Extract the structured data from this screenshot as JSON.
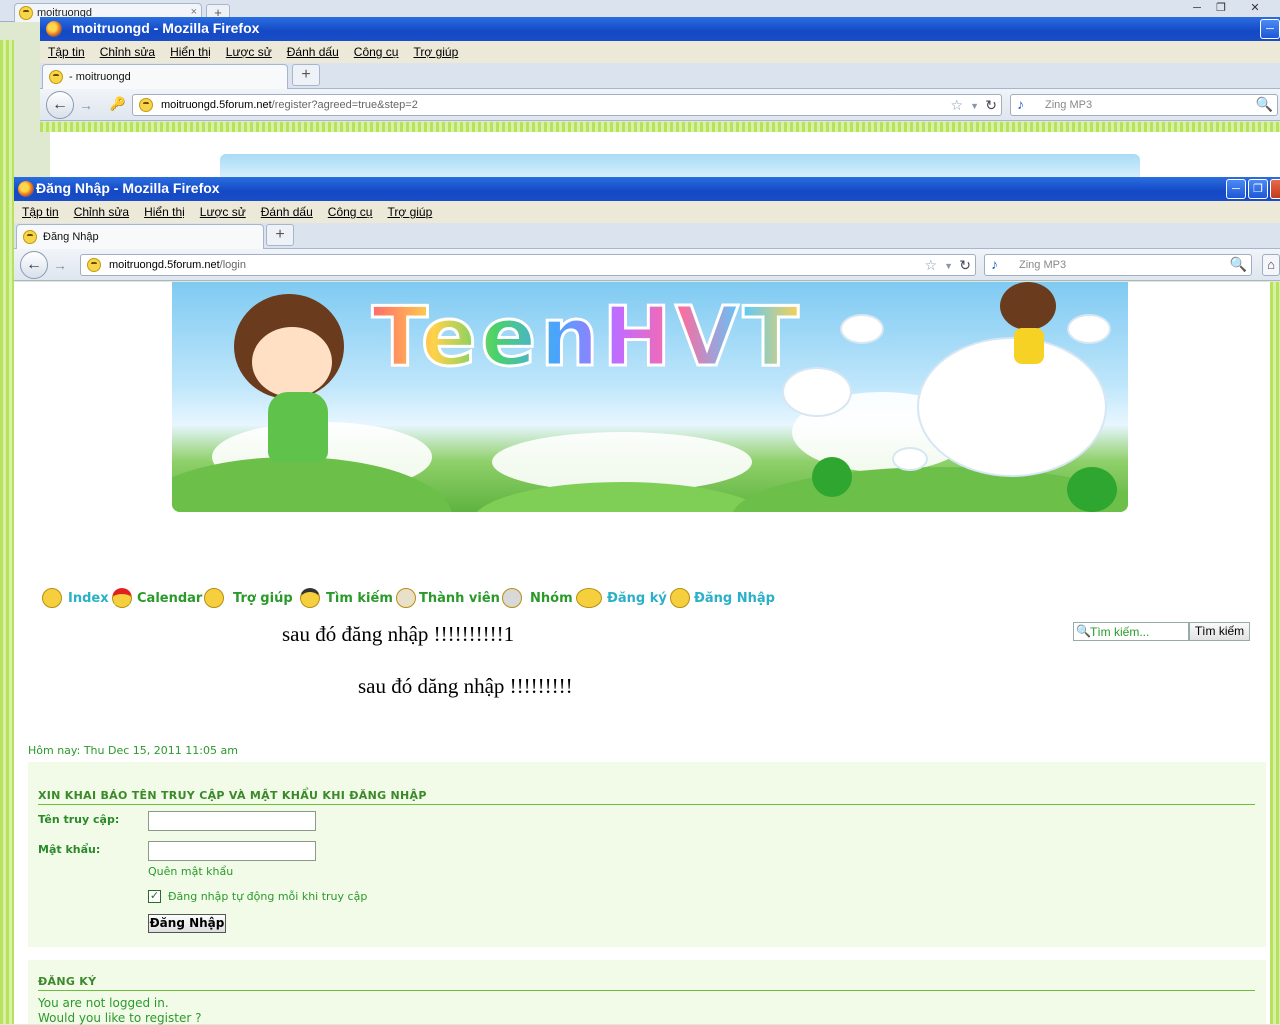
{
  "back_window": {
    "tab_label": "moitruongd",
    "controls": [
      "─",
      "❐",
      "✕"
    ]
  },
  "window1": {
    "title": "moitruongd - Mozilla Firefox",
    "menu": [
      "Tập tin",
      "Chỉnh sửa",
      "Hiển thị",
      "Lược sử",
      "Đánh dấu",
      "Công cụ",
      "Trợ giúp"
    ],
    "tab_label": "- moitruongd",
    "url_domain": "moitruongd.5forum.net",
    "url_path": "/register?agreed=true&step=2",
    "search_placeholder": "Zing MP3"
  },
  "window2": {
    "title": "Đăng Nhập - Mozilla Firefox",
    "menu": [
      "Tập tin",
      "Chỉnh sửa",
      "Hiển thị",
      "Lược sử",
      "Đánh dấu",
      "Công cụ",
      "Trợ giúp"
    ],
    "tab_label": "Đăng Nhập",
    "url_domain": "moitruongd.5forum.net",
    "url_path": "/login",
    "search_placeholder": "Zing MP3"
  },
  "page": {
    "banner_text": "TeenHVT",
    "nav": [
      {
        "label": "Index",
        "icon": "grin-smiley-icon"
      },
      {
        "label": "Calendar",
        "icon": "santa-smiley-icon"
      },
      {
        "label": "Trợ giúp",
        "icon": "thinking-smiley-icon"
      },
      {
        "label": "Tìm kiếm",
        "icon": "glasses-smiley-icon"
      },
      {
        "label": "Thành viên",
        "icon": "members-smiley-icon"
      },
      {
        "label": "Nhóm",
        "icon": "group-smiley-icon"
      },
      {
        "label": "Đăng ký",
        "icon": "register-smiley-icon"
      },
      {
        "label": "Đăng Nhập",
        "icon": "login-smiley-icon"
      }
    ],
    "search_placeholder": "Tìm kiếm...",
    "search_button": "Tìm kiếm",
    "annotation_1": "sau đó đăng nhập !!!!!!!!!!1",
    "annotation_2": "sau đó dăng nhập !!!!!!!!!",
    "date_line": "Hôm nay: Thu Dec 15, 2011 11:05 am",
    "login": {
      "heading": "XIN KHAI BÁO TÊN TRUY CẬP VÀ MẬT KHẨU KHI ĐĂNG NHẬP",
      "username_label": "Tên truy cập:",
      "username_value": "",
      "password_label": "Mật khẩu:",
      "password_value": "",
      "forgot_link": "Quên mật khẩu",
      "autologin_label": "Đăng nhập tự động mỗi khi truy cập",
      "autologin_checked": true,
      "submit_label": "Đăng Nhập"
    },
    "register": {
      "heading": "ĐĂNG KÝ",
      "line1": "You are not logged in.",
      "line2": "Would you like to register ?"
    }
  },
  "colors": {
    "titlebar": "#1448c5",
    "menubar": "#ece9d8",
    "link_green": "#2a9a2a",
    "link_cyan": "#2ab0c8",
    "panel_bg": "#f2fbe8",
    "rule": "#6cbf3a"
  }
}
